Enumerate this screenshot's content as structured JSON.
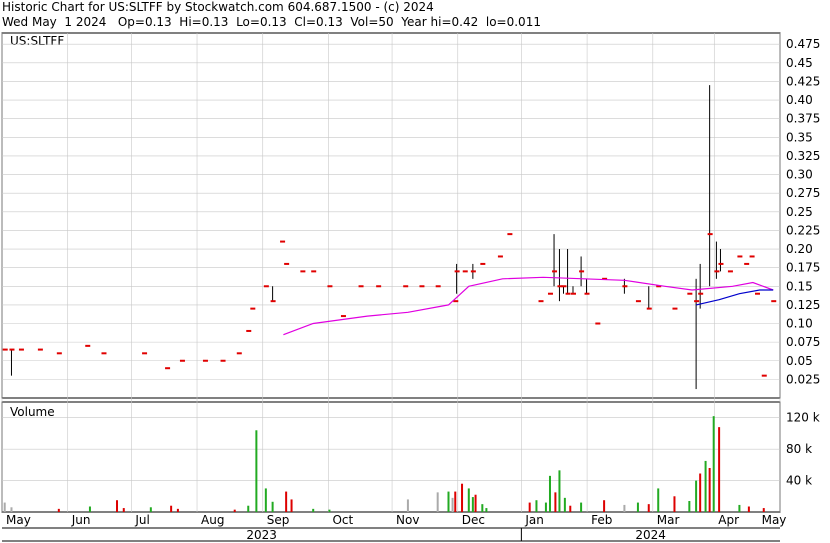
{
  "header": {
    "line1": "Historic Chart for US:SLTFF by Stockwatch.com 604.687.1500 - (c) 2024",
    "line2": "Wed May  1 2024   Op=0.13  Hi=0.13  Lo=0.13  Cl=0.13  Vol=50  Year hi=0.42  lo=0.011"
  },
  "chart_data": {
    "type": "line",
    "symbol": "US:SLTFF",
    "price_axis": {
      "ylim": [
        0,
        0.49
      ],
      "ticks": [
        "0.025",
        "0.05",
        "0.075",
        "0.10",
        "0.125",
        "0.15",
        "0.175",
        "0.20",
        "0.225",
        "0.25",
        "0.275",
        "0.30",
        "0.325",
        "0.35",
        "0.375",
        "0.40",
        "0.425",
        "0.45",
        "0.475"
      ]
    },
    "volume_axis": {
      "label": "Volume",
      "ylim": [
        0,
        140000
      ],
      "ticks": [
        "40 k",
        "80 k",
        "120 k"
      ]
    },
    "months": [
      "May",
      "Jun",
      "Jul",
      "Aug",
      "Sep",
      "Oct",
      "Nov",
      "Dec",
      "Jan",
      "Feb",
      "Mar",
      "Apr",
      "May"
    ],
    "years": [
      "2023",
      "2024"
    ],
    "colors": {
      "price": "#e00000",
      "bar": "#000000",
      "ma_long": "#e000e0",
      "ma_short": "#0000cc",
      "vol_up": "#22aa22",
      "vol_down": "#dd0000",
      "vol_flat": "#aaaaaa",
      "grid": "#c8c8c8"
    },
    "price_bars": [
      {
        "d": 2,
        "hi": 0.065,
        "lo": 0.065,
        "c": 0.065
      },
      {
        "d": 7,
        "hi": 0.065,
        "lo": 0.03,
        "c": 0.065
      },
      {
        "d": 14,
        "hi": 0.065,
        "lo": 0.065,
        "c": 0.065
      },
      {
        "d": 28,
        "hi": 0.065,
        "lo": 0.065,
        "c": 0.065
      },
      {
        "d": 42,
        "hi": 0.06,
        "lo": 0.06,
        "c": 0.06
      },
      {
        "d": 63,
        "hi": 0.07,
        "lo": 0.07,
        "c": 0.07
      },
      {
        "d": 75,
        "hi": 0.06,
        "lo": 0.06,
        "c": 0.06
      },
      {
        "d": 105,
        "hi": 0.06,
        "lo": 0.06,
        "c": 0.06
      },
      {
        "d": 122,
        "hi": 0.04,
        "lo": 0.04,
        "c": 0.04
      },
      {
        "d": 133,
        "hi": 0.05,
        "lo": 0.05,
        "c": 0.05
      },
      {
        "d": 150,
        "hi": 0.05,
        "lo": 0.05,
        "c": 0.05
      },
      {
        "d": 163,
        "hi": 0.05,
        "lo": 0.05,
        "c": 0.05
      },
      {
        "d": 175,
        "hi": 0.06,
        "lo": 0.06,
        "c": 0.06
      },
      {
        "d": 182,
        "hi": 0.09,
        "lo": 0.09,
        "c": 0.09
      },
      {
        "d": 185,
        "hi": 0.12,
        "lo": 0.12,
        "c": 0.12
      },
      {
        "d": 195,
        "hi": 0.15,
        "lo": 0.15,
        "c": 0.15
      },
      {
        "d": 200,
        "hi": 0.15,
        "lo": 0.13,
        "c": 0.13
      },
      {
        "d": 207,
        "hi": 0.21,
        "lo": 0.21,
        "c": 0.21
      },
      {
        "d": 210,
        "hi": 0.18,
        "lo": 0.18,
        "c": 0.18
      },
      {
        "d": 222,
        "hi": 0.17,
        "lo": 0.17,
        "c": 0.17
      },
      {
        "d": 230,
        "hi": 0.17,
        "lo": 0.17,
        "c": 0.17
      },
      {
        "d": 242,
        "hi": 0.15,
        "lo": 0.15,
        "c": 0.15
      },
      {
        "d": 252,
        "hi": 0.11,
        "lo": 0.11,
        "c": 0.11
      },
      {
        "d": 265,
        "hi": 0.15,
        "lo": 0.15,
        "c": 0.15
      },
      {
        "d": 278,
        "hi": 0.15,
        "lo": 0.15,
        "c": 0.15
      },
      {
        "d": 298,
        "hi": 0.15,
        "lo": 0.15,
        "c": 0.15
      },
      {
        "d": 310,
        "hi": 0.15,
        "lo": 0.15,
        "c": 0.15
      },
      {
        "d": 322,
        "hi": 0.15,
        "lo": 0.15,
        "c": 0.15
      },
      {
        "d": 335,
        "hi": 0.13,
        "lo": 0.13,
        "c": 0.13
      },
      {
        "d": 336,
        "hi": 0.18,
        "lo": 0.14,
        "c": 0.17
      },
      {
        "d": 342,
        "hi": 0.17,
        "lo": 0.17,
        "c": 0.17
      },
      {
        "d": 348,
        "hi": 0.18,
        "lo": 0.16,
        "c": 0.17
      },
      {
        "d": 355,
        "hi": 0.18,
        "lo": 0.18,
        "c": 0.18
      },
      {
        "d": 368,
        "hi": 0.19,
        "lo": 0.19,
        "c": 0.19
      },
      {
        "d": 375,
        "hi": 0.22,
        "lo": 0.22,
        "c": 0.22
      },
      {
        "d": 398,
        "hi": 0.13,
        "lo": 0.13,
        "c": 0.13
      },
      {
        "d": 405,
        "hi": 0.14,
        "lo": 0.14,
        "c": 0.14
      },
      {
        "d": 408,
        "hi": 0.22,
        "lo": 0.15,
        "c": 0.17
      },
      {
        "d": 412,
        "hi": 0.2,
        "lo": 0.13,
        "c": 0.15
      },
      {
        "d": 415,
        "hi": 0.15,
        "lo": 0.14,
        "c": 0.15
      },
      {
        "d": 418,
        "hi": 0.2,
        "lo": 0.14,
        "c": 0.14
      },
      {
        "d": 422,
        "hi": 0.15,
        "lo": 0.14,
        "c": 0.14
      },
      {
        "d": 428,
        "hi": 0.19,
        "lo": 0.15,
        "c": 0.17
      },
      {
        "d": 432,
        "hi": 0.16,
        "lo": 0.14,
        "c": 0.14
      },
      {
        "d": 440,
        "hi": 0.1,
        "lo": 0.1,
        "c": 0.1
      },
      {
        "d": 445,
        "hi": 0.16,
        "lo": 0.16,
        "c": 0.16
      },
      {
        "d": 460,
        "hi": 0.16,
        "lo": 0.14,
        "c": 0.15
      },
      {
        "d": 470,
        "hi": 0.13,
        "lo": 0.13,
        "c": 0.13
      },
      {
        "d": 478,
        "hi": 0.15,
        "lo": 0.12,
        "c": 0.12
      },
      {
        "d": 485,
        "hi": 0.15,
        "lo": 0.15,
        "c": 0.15
      },
      {
        "d": 497,
        "hi": 0.12,
        "lo": 0.12,
        "c": 0.12
      },
      {
        "d": 508,
        "hi": 0.14,
        "lo": 0.14,
        "c": 0.14
      },
      {
        "d": 513,
        "hi": 0.16,
        "lo": 0.012,
        "c": 0.13
      },
      {
        "d": 516,
        "hi": 0.18,
        "lo": 0.12,
        "c": 0.14
      },
      {
        "d": 523,
        "hi": 0.42,
        "lo": 0.15,
        "c": 0.22
      },
      {
        "d": 528,
        "hi": 0.21,
        "lo": 0.16,
        "c": 0.17
      },
      {
        "d": 531,
        "hi": 0.2,
        "lo": 0.17,
        "c": 0.18
      },
      {
        "d": 538,
        "hi": 0.17,
        "lo": 0.17,
        "c": 0.17
      },
      {
        "d": 545,
        "hi": 0.19,
        "lo": 0.19,
        "c": 0.19
      },
      {
        "d": 550,
        "hi": 0.18,
        "lo": 0.18,
        "c": 0.18
      },
      {
        "d": 554,
        "hi": 0.19,
        "lo": 0.19,
        "c": 0.19
      },
      {
        "d": 558,
        "hi": 0.14,
        "lo": 0.14,
        "c": 0.14
      },
      {
        "d": 563,
        "hi": 0.03,
        "lo": 0.03,
        "c": 0.03
      },
      {
        "d": 570,
        "hi": 0.13,
        "lo": 0.13,
        "c": 0.13
      }
    ],
    "ma_long": [
      [
        208,
        0.085
      ],
      [
        230,
        0.1
      ],
      [
        270,
        0.11
      ],
      [
        300,
        0.115
      ],
      [
        330,
        0.125
      ],
      [
        345,
        0.15
      ],
      [
        370,
        0.16
      ],
      [
        400,
        0.162
      ],
      [
        430,
        0.16
      ],
      [
        460,
        0.158
      ],
      [
        490,
        0.15
      ],
      [
        510,
        0.145
      ],
      [
        540,
        0.15
      ],
      [
        555,
        0.155
      ],
      [
        570,
        0.145
      ]
    ],
    "ma_short": [
      [
        513,
        0.125
      ],
      [
        530,
        0.132
      ],
      [
        545,
        0.14
      ],
      [
        560,
        0.145
      ],
      [
        570,
        0.145
      ]
    ],
    "volumes": [
      {
        "d": 2,
        "v": 12000,
        "c": "flat"
      },
      {
        "d": 7,
        "v": 6000,
        "c": "flat"
      },
      {
        "d": 42,
        "v": 4000,
        "c": "down"
      },
      {
        "d": 65,
        "v": 7000,
        "c": "up"
      },
      {
        "d": 85,
        "v": 15000,
        "c": "down"
      },
      {
        "d": 90,
        "v": 5000,
        "c": "down"
      },
      {
        "d": 110,
        "v": 6000,
        "c": "up"
      },
      {
        "d": 125,
        "v": 8000,
        "c": "down"
      },
      {
        "d": 130,
        "v": 4000,
        "c": "down"
      },
      {
        "d": 172,
        "v": 3000,
        "c": "down"
      },
      {
        "d": 182,
        "v": 8000,
        "c": "up"
      },
      {
        "d": 188,
        "v": 104000,
        "c": "up"
      },
      {
        "d": 195,
        "v": 30000,
        "c": "up"
      },
      {
        "d": 200,
        "v": 13000,
        "c": "up"
      },
      {
        "d": 210,
        "v": 26000,
        "c": "down"
      },
      {
        "d": 214,
        "v": 16000,
        "c": "down"
      },
      {
        "d": 230,
        "v": 4000,
        "c": "up"
      },
      {
        "d": 242,
        "v": 3000,
        "c": "up"
      },
      {
        "d": 300,
        "v": 16000,
        "c": "flat"
      },
      {
        "d": 322,
        "v": 25000,
        "c": "flat"
      },
      {
        "d": 330,
        "v": 26000,
        "c": "up"
      },
      {
        "d": 333,
        "v": 18000,
        "c": "flat"
      },
      {
        "d": 335,
        "v": 26000,
        "c": "down"
      },
      {
        "d": 340,
        "v": 36000,
        "c": "down"
      },
      {
        "d": 345,
        "v": 30000,
        "c": "up"
      },
      {
        "d": 348,
        "v": 19000,
        "c": "up"
      },
      {
        "d": 350,
        "v": 22000,
        "c": "down"
      },
      {
        "d": 355,
        "v": 10000,
        "c": "up"
      },
      {
        "d": 358,
        "v": 5000,
        "c": "up"
      },
      {
        "d": 390,
        "v": 12000,
        "c": "down"
      },
      {
        "d": 395,
        "v": 15000,
        "c": "up"
      },
      {
        "d": 402,
        "v": 12000,
        "c": "up"
      },
      {
        "d": 405,
        "v": 46000,
        "c": "up"
      },
      {
        "d": 409,
        "v": 25000,
        "c": "down"
      },
      {
        "d": 412,
        "v": 53000,
        "c": "up"
      },
      {
        "d": 416,
        "v": 18000,
        "c": "up"
      },
      {
        "d": 420,
        "v": 8000,
        "c": "down"
      },
      {
        "d": 428,
        "v": 12000,
        "c": "up"
      },
      {
        "d": 445,
        "v": 15000,
        "c": "down"
      },
      {
        "d": 460,
        "v": 9000,
        "c": "flat"
      },
      {
        "d": 470,
        "v": 12000,
        "c": "up"
      },
      {
        "d": 478,
        "v": 10000,
        "c": "down"
      },
      {
        "d": 485,
        "v": 30000,
        "c": "up"
      },
      {
        "d": 497,
        "v": 20000,
        "c": "down"
      },
      {
        "d": 508,
        "v": 14000,
        "c": "up"
      },
      {
        "d": 513,
        "v": 40000,
        "c": "up"
      },
      {
        "d": 516,
        "v": 49000,
        "c": "down"
      },
      {
        "d": 520,
        "v": 65000,
        "c": "up"
      },
      {
        "d": 523,
        "v": 56000,
        "c": "down"
      },
      {
        "d": 526,
        "v": 122000,
        "c": "up"
      },
      {
        "d": 530,
        "v": 108000,
        "c": "down"
      },
      {
        "d": 545,
        "v": 9000,
        "c": "up"
      },
      {
        "d": 552,
        "v": 7000,
        "c": "down"
      },
      {
        "d": 563,
        "v": 5000,
        "c": "down"
      }
    ]
  }
}
